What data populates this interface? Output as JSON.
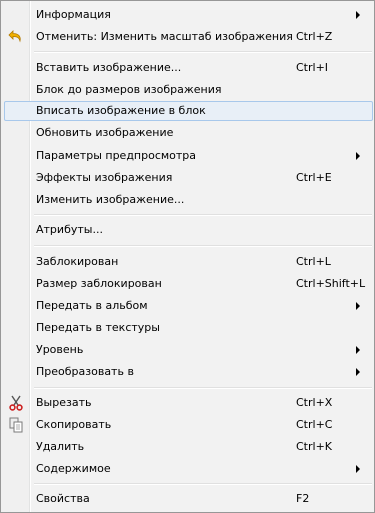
{
  "menu": {
    "items": [
      {
        "label": "Информация",
        "shortcut": "",
        "submenu": true
      },
      {
        "label": "Отменить: Изменить масштаб изображения",
        "shortcut": "Ctrl+Z",
        "submenu": false,
        "icon": "undo-icon"
      },
      {
        "label": "Вставить изображение...",
        "shortcut": "Ctrl+I",
        "submenu": false
      },
      {
        "label": "Блок до размеров изображения",
        "shortcut": "",
        "submenu": false
      },
      {
        "label": "Вписать изображение в блок",
        "shortcut": "",
        "submenu": false,
        "highlighted": true
      },
      {
        "label": "Обновить изображение",
        "shortcut": "",
        "submenu": false
      },
      {
        "label": "Параметры предпросмотра",
        "shortcut": "",
        "submenu": true
      },
      {
        "label": "Эффекты изображения",
        "shortcut": "Ctrl+E",
        "submenu": false
      },
      {
        "label": "Изменить изображение...",
        "shortcut": "",
        "submenu": false
      },
      {
        "label": "Атрибуты...",
        "shortcut": "",
        "submenu": false
      },
      {
        "label": "Заблокирован",
        "shortcut": "Ctrl+L",
        "submenu": false
      },
      {
        "label": "Размер заблокирован",
        "shortcut": "Ctrl+Shift+L",
        "submenu": false
      },
      {
        "label": "Передать в альбом",
        "shortcut": "",
        "submenu": true
      },
      {
        "label": "Передать в текстуры",
        "shortcut": "",
        "submenu": false
      },
      {
        "label": "Уровень",
        "shortcut": "",
        "submenu": true
      },
      {
        "label": "Преобразовать в",
        "shortcut": "",
        "submenu": true
      },
      {
        "label": "Вырезать",
        "shortcut": "Ctrl+X",
        "submenu": false,
        "icon": "scissors-icon"
      },
      {
        "label": "Скопировать",
        "shortcut": "Ctrl+C",
        "submenu": false,
        "icon": "copy-icon"
      },
      {
        "label": "Удалить",
        "shortcut": "Ctrl+K",
        "submenu": false
      },
      {
        "label": "Содержимое",
        "shortcut": "",
        "submenu": true
      },
      {
        "label": "Свойства",
        "shortcut": "F2",
        "submenu": false
      }
    ]
  },
  "colors": {
    "highlight_bg": "#e8eff7",
    "highlight_border": "#a8c8eb",
    "undo_icon": "#f0b000",
    "scissors_icon": "#cc2020"
  }
}
